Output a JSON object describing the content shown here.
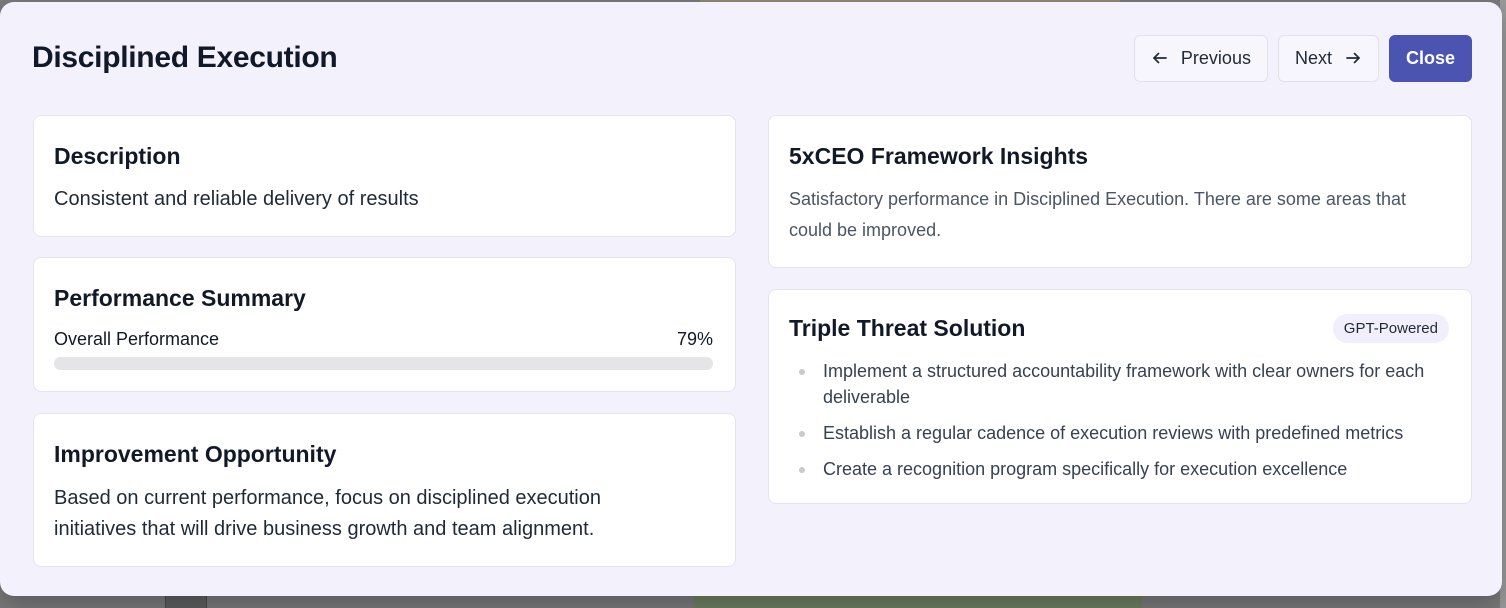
{
  "modal": {
    "title": "Disciplined Execution",
    "buttons": {
      "previous": "Previous",
      "next": "Next",
      "close": "Close"
    }
  },
  "description": {
    "title": "Description",
    "text": "Consistent and reliable delivery of results"
  },
  "performance": {
    "title": "Performance Summary",
    "label": "Overall Performance",
    "value_text": "79%",
    "value": 79
  },
  "improvement": {
    "title": "Improvement Opportunity",
    "text": "Based on current performance, focus on disciplined execution initiatives that will drive business growth and team alignment."
  },
  "insights": {
    "title": "5xCEO Framework Insights",
    "text": "Satisfactory performance in Disciplined Execution. There are some areas that could be improved."
  },
  "solution": {
    "title": "Triple Threat Solution",
    "badge": "GPT-Powered",
    "items": [
      "Implement a structured accountability framework with clear owners for each deliverable",
      "Establish a regular cadence of execution reviews with predefined metrics",
      "Create a recognition program specifically for execution excellence"
    ]
  },
  "colors": {
    "modal_bg": "#f3f1fc",
    "primary": "#4b54b0",
    "card_border": "#e5e4ee",
    "progress_track": "#e5e5e8"
  },
  "icons": {
    "previous": "arrow-left-icon",
    "next": "arrow-right-icon"
  }
}
